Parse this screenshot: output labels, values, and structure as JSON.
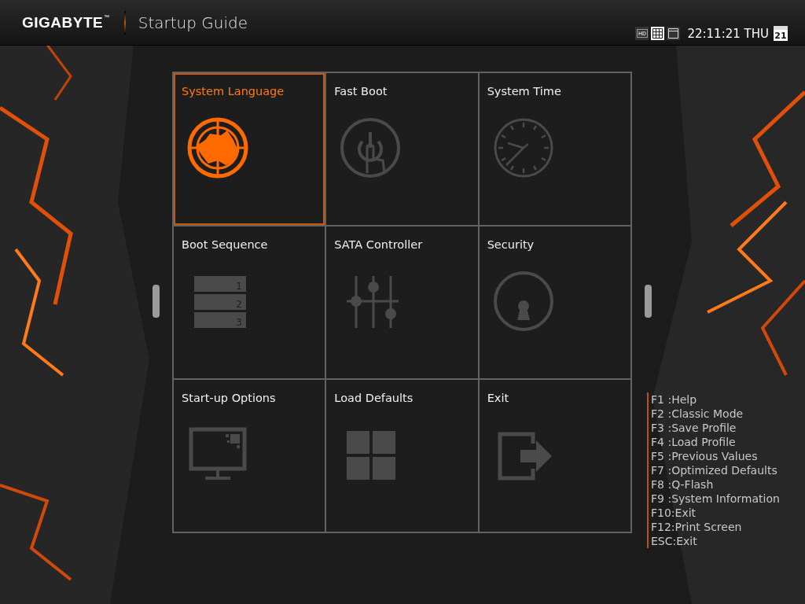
{
  "header": {
    "brand": "GIGABYTE",
    "trademark": "™",
    "title": "Startup Guide",
    "views": [
      {
        "kind": "hd",
        "label": "HD",
        "selected": false
      },
      {
        "kind": "grid",
        "selected": true
      },
      {
        "kind": "single",
        "selected": false
      }
    ],
    "clock": "22:11:21 THU",
    "calendar_day": "21"
  },
  "tiles": [
    {
      "title": "System Language",
      "kind": "globe",
      "selected": true
    },
    {
      "title": "Fast Boot",
      "kind": "power",
      "selected": false
    },
    {
      "title": "System Time",
      "kind": "clock",
      "selected": false
    },
    {
      "title": "Boot Sequence",
      "kind": "list",
      "selected": false,
      "slots": [
        "1",
        "2",
        "3"
      ]
    },
    {
      "title": "SATA Controller",
      "kind": "sliders",
      "selected": false
    },
    {
      "title": "Security",
      "kind": "lock",
      "selected": false
    },
    {
      "title": "Start-up Options",
      "kind": "monitor",
      "selected": false
    },
    {
      "title": "Load Defaults",
      "kind": "tiles",
      "selected": false
    },
    {
      "title": "Exit",
      "kind": "exit",
      "selected": false
    }
  ],
  "hotkeys": [
    "F1 :Help",
    "F2 :Classic Mode",
    "F3 :Save Profile",
    "F4 :Load Profile",
    "F5 :Previous Values",
    "F7 :Optimized Defaults",
    "F8 :Q-Flash",
    "F9 :System Information",
    "F10:Exit",
    "F12:Print Screen",
    "ESC:Exit"
  ]
}
